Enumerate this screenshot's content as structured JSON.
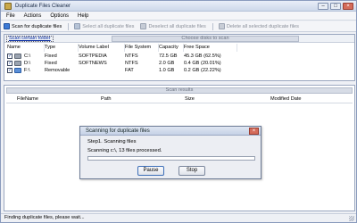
{
  "window": {
    "title": "Duplicate Files Cleaner",
    "controls": [
      "–",
      "□",
      "×"
    ]
  },
  "menu": [
    "File",
    "Actions",
    "Options",
    "Help"
  ],
  "toolbar": {
    "scan": "Scan for duplicate files",
    "select_all": "Select all duplicate files",
    "deselect_all": "Deselect all duplicate files",
    "delete_all": "Delete all selected duplicate files"
  },
  "disks": {
    "scan_link": "Scan certain folder",
    "header": "Choose disks to scan",
    "columns": [
      "Name",
      "Type",
      "Volume Label",
      "File System",
      "Capacity",
      "Free Space"
    ],
    "rows": [
      {
        "checked": true,
        "name": "C:\\",
        "type": "Fixed",
        "label": "SOFTPEDIA",
        "fs": "NTFS",
        "capacity": "72.5 GB",
        "free": "45.3 GB (62.5%)",
        "icon": "hard-drive-icon"
      },
      {
        "checked": true,
        "name": "D:\\",
        "type": "Fixed",
        "label": "SOFTNEWS",
        "fs": "NTFS",
        "capacity": "2.0 GB",
        "free": "0.4 GB (20.01%)",
        "icon": "hard-drive-icon"
      },
      {
        "checked": true,
        "name": "F:\\",
        "type": "Removable",
        "label": "",
        "fs": "FAT",
        "capacity": "1.0 GB",
        "free": "0.2 GB (22.22%)",
        "icon": "removable-drive-icon"
      }
    ]
  },
  "results": {
    "header": "Scan results",
    "columns": [
      "FileName",
      "Path",
      "Size",
      "Modified Date"
    ]
  },
  "dialog": {
    "title": "Scanning for duplicate files",
    "close": "×",
    "step": "Step1. Scanning files",
    "progress_text": "Scanning c:\\, 13 files processed.",
    "progress": 0.0,
    "pause": "Pause",
    "stop": "Stop"
  },
  "status": "Finding duplicate files, please wait..."
}
